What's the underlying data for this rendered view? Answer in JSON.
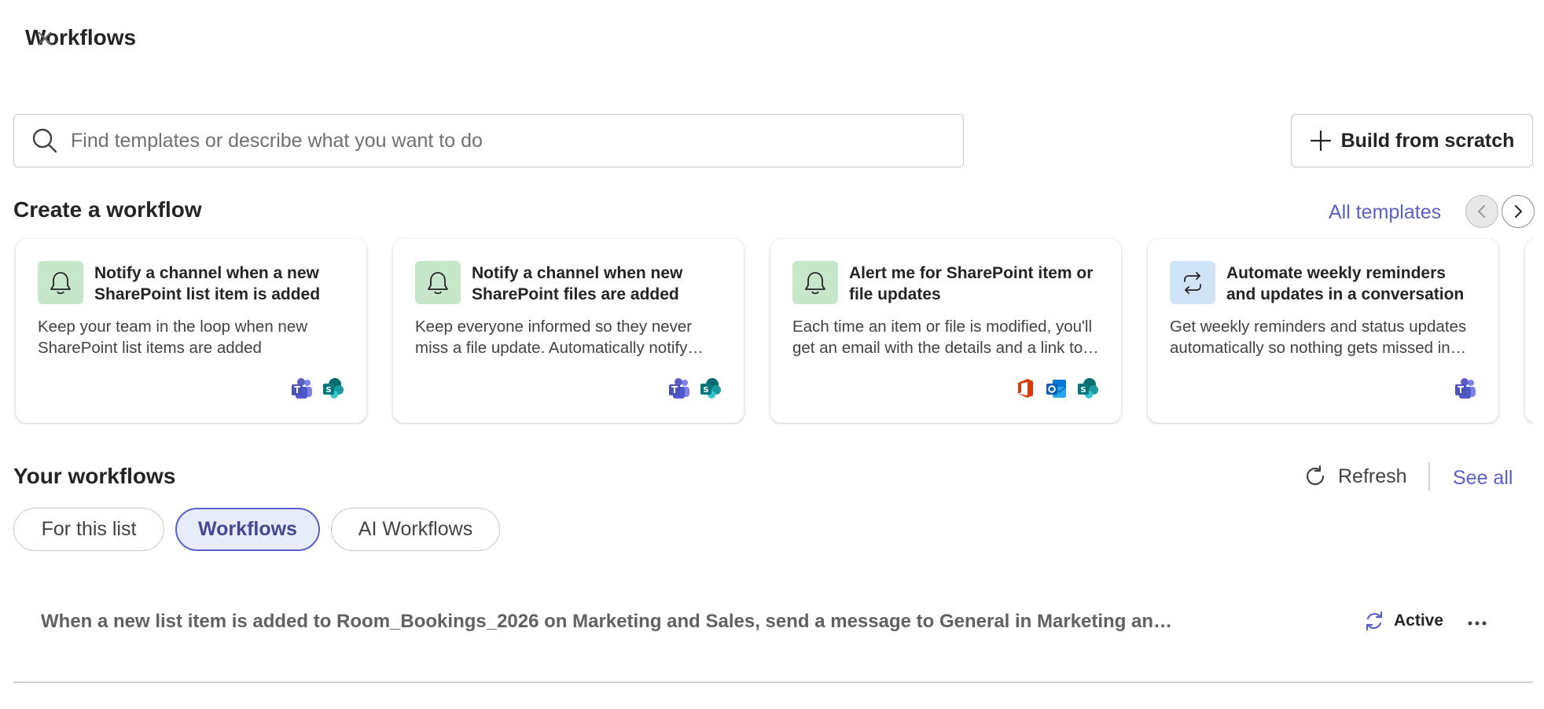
{
  "header": {
    "title": "Workflows",
    "close_icon": "close-icon"
  },
  "search": {
    "placeholder": "Find templates or describe what you want to do",
    "icon": "search-icon"
  },
  "build_button": {
    "label": "Build from scratch",
    "icon": "plus-icon"
  },
  "create_section": {
    "title": "Create a workflow",
    "all_templates_label": "All templates",
    "cards": [
      {
        "title": "Notify a channel when a new SharePoint list item is added",
        "description": "Keep your team in the loop when new SharePoint list items are added",
        "icon": "bell-icon",
        "apps": [
          "teams-icon",
          "sharepoint-icon"
        ]
      },
      {
        "title": "Notify a channel when new SharePoint files are added",
        "description": "Keep everyone informed so they never miss a file update. Automatically notify your channel when new files are added",
        "icon": "bell-icon",
        "apps": [
          "teams-icon",
          "sharepoint-icon"
        ]
      },
      {
        "title": "Alert me for SharePoint item or file updates",
        "description": "Each time an item or file is modified, you'll get an email with the details and a link to the item",
        "icon": "bell-icon",
        "apps": [
          "office-icon",
          "outlook-icon",
          "sharepoint-icon"
        ]
      },
      {
        "title": "Automate weekly reminders and updates in a conversation",
        "description": "Get weekly reminders and status updates automatically so nothing gets missed in your conversation",
        "icon": "repeat-icon",
        "apps": [
          "teams-icon"
        ]
      }
    ]
  },
  "your_workflows": {
    "title": "Your workflows",
    "refresh_label": "Refresh",
    "see_all_label": "See all",
    "tabs": [
      {
        "label": "For this list",
        "selected": false
      },
      {
        "label": "Workflows",
        "selected": true
      },
      {
        "label": "AI Workflows",
        "selected": false
      }
    ],
    "items": [
      {
        "text": "When a new list item is added to Room_Bookings_2026 on Marketing and Sales, send a message to General in Marketing and Sales",
        "status": "Active"
      }
    ]
  },
  "colors": {
    "accent": "#5b5fc7",
    "tab_selected_bg": "#e8ebfa",
    "card_icon_green": "#c7e7cb",
    "card_icon_blue": "#cfe4f7"
  }
}
